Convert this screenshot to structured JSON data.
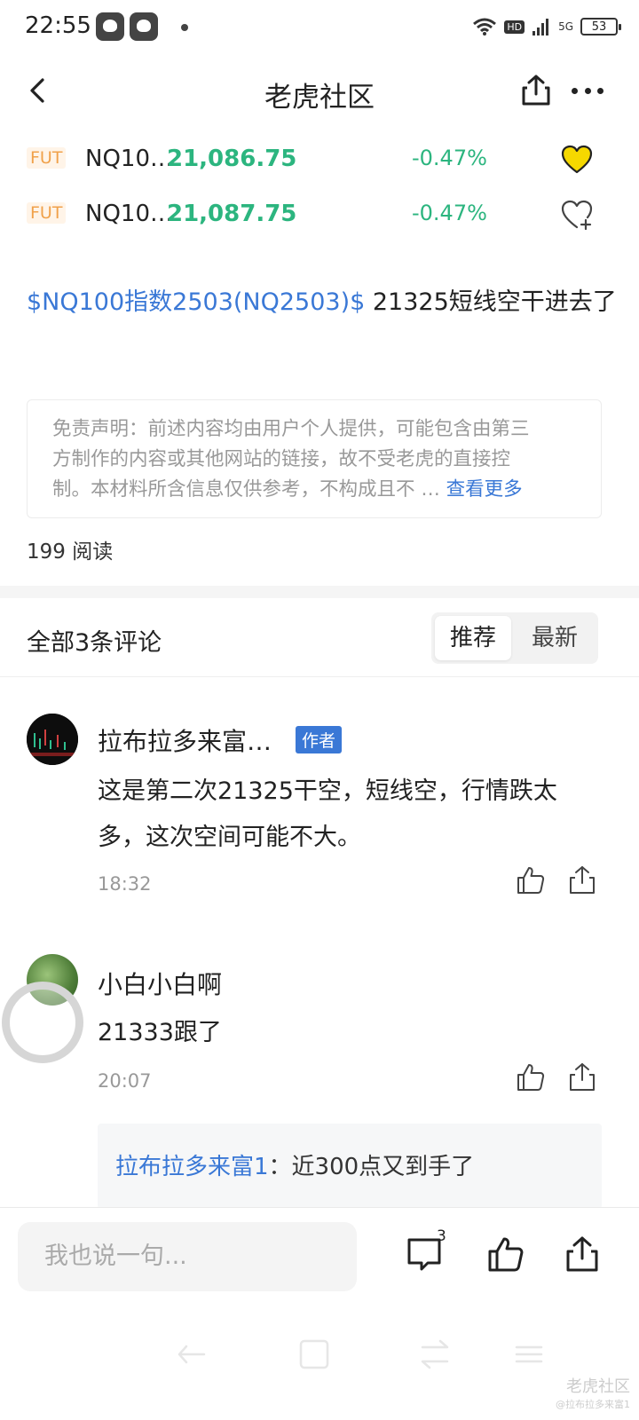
{
  "status_bar": {
    "time": "22:55",
    "hd": "HD",
    "network": "5G",
    "battery": "53"
  },
  "header": {
    "title": "老虎社区"
  },
  "quotes": [
    {
      "badge": "FUT",
      "symbol": "NQ10…",
      "price": "21,086.75",
      "change": "-0.47%",
      "favorited": true
    },
    {
      "badge": "FUT",
      "symbol": "NQ10…",
      "price": "21,087.75",
      "change": "-0.47%",
      "favorited": false
    }
  ],
  "post": {
    "tag": "$NQ100指数2503(NQ2503)$",
    "text": " 21325短线空干进去了"
  },
  "disclaimer": {
    "line1": "免责声明：前述内容均由用户个人提供，可能包含由第三",
    "line2": "方制作的内容或其他网站的链接，故不受老虎的直接控",
    "line3": "制。本材料所含信息仅供参考，不构成且不  …  ",
    "see_more": "查看更多"
  },
  "read_count": "199 阅读",
  "comments_header": {
    "title": "全部3条评论",
    "sort_recommended": "推荐",
    "sort_latest": "最新"
  },
  "comments": [
    {
      "name": "拉布拉多来富…",
      "badge": "作者",
      "line1": "这是第二次21325干空，短线空，行情跌太",
      "line2": "多，这次空间可能不大。",
      "time": "18:32"
    },
    {
      "name": "小白小白啊",
      "line1": "21333跟了",
      "time": "20:07",
      "reply": {
        "name": "拉布拉多来富1",
        "text": "：近300点又到手了"
      }
    }
  ],
  "bottom_bar": {
    "input_placeholder": "我也说一句...",
    "comment_count": "3"
  },
  "watermark": {
    "brand": "老虎社区",
    "user": "@拉布拉多来富1"
  },
  "colors": {
    "accent_blue": "#3a78d6",
    "price_green": "#2cb57f",
    "fut_orange": "#f0a14a",
    "heart_yellow": "#f5d800"
  }
}
